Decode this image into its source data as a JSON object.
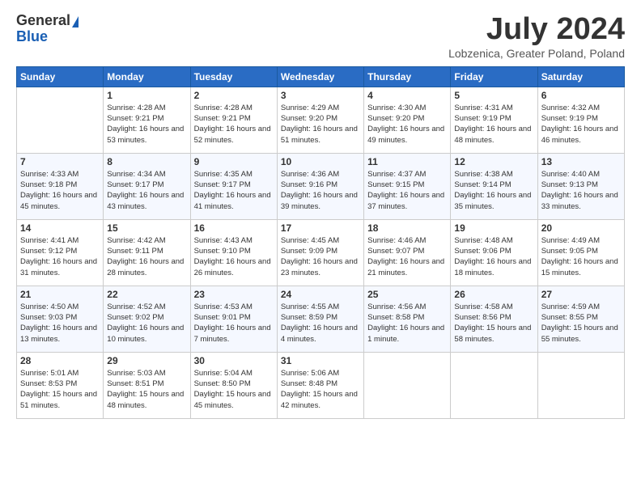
{
  "logo": {
    "general": "General",
    "blue": "Blue"
  },
  "title": "July 2024",
  "location": "Lobzenica, Greater Poland, Poland",
  "days_header": [
    "Sunday",
    "Monday",
    "Tuesday",
    "Wednesday",
    "Thursday",
    "Friday",
    "Saturday"
  ],
  "weeks": [
    [
      {
        "day": "",
        "info": ""
      },
      {
        "day": "1",
        "info": "Sunrise: 4:28 AM\nSunset: 9:21 PM\nDaylight: 16 hours\nand 53 minutes."
      },
      {
        "day": "2",
        "info": "Sunrise: 4:28 AM\nSunset: 9:21 PM\nDaylight: 16 hours\nand 52 minutes."
      },
      {
        "day": "3",
        "info": "Sunrise: 4:29 AM\nSunset: 9:20 PM\nDaylight: 16 hours\nand 51 minutes."
      },
      {
        "day": "4",
        "info": "Sunrise: 4:30 AM\nSunset: 9:20 PM\nDaylight: 16 hours\nand 49 minutes."
      },
      {
        "day": "5",
        "info": "Sunrise: 4:31 AM\nSunset: 9:19 PM\nDaylight: 16 hours\nand 48 minutes."
      },
      {
        "day": "6",
        "info": "Sunrise: 4:32 AM\nSunset: 9:19 PM\nDaylight: 16 hours\nand 46 minutes."
      }
    ],
    [
      {
        "day": "7",
        "info": "Sunrise: 4:33 AM\nSunset: 9:18 PM\nDaylight: 16 hours\nand 45 minutes."
      },
      {
        "day": "8",
        "info": "Sunrise: 4:34 AM\nSunset: 9:17 PM\nDaylight: 16 hours\nand 43 minutes."
      },
      {
        "day": "9",
        "info": "Sunrise: 4:35 AM\nSunset: 9:17 PM\nDaylight: 16 hours\nand 41 minutes."
      },
      {
        "day": "10",
        "info": "Sunrise: 4:36 AM\nSunset: 9:16 PM\nDaylight: 16 hours\nand 39 minutes."
      },
      {
        "day": "11",
        "info": "Sunrise: 4:37 AM\nSunset: 9:15 PM\nDaylight: 16 hours\nand 37 minutes."
      },
      {
        "day": "12",
        "info": "Sunrise: 4:38 AM\nSunset: 9:14 PM\nDaylight: 16 hours\nand 35 minutes."
      },
      {
        "day": "13",
        "info": "Sunrise: 4:40 AM\nSunset: 9:13 PM\nDaylight: 16 hours\nand 33 minutes."
      }
    ],
    [
      {
        "day": "14",
        "info": "Sunrise: 4:41 AM\nSunset: 9:12 PM\nDaylight: 16 hours\nand 31 minutes."
      },
      {
        "day": "15",
        "info": "Sunrise: 4:42 AM\nSunset: 9:11 PM\nDaylight: 16 hours\nand 28 minutes."
      },
      {
        "day": "16",
        "info": "Sunrise: 4:43 AM\nSunset: 9:10 PM\nDaylight: 16 hours\nand 26 minutes."
      },
      {
        "day": "17",
        "info": "Sunrise: 4:45 AM\nSunset: 9:09 PM\nDaylight: 16 hours\nand 23 minutes."
      },
      {
        "day": "18",
        "info": "Sunrise: 4:46 AM\nSunset: 9:07 PM\nDaylight: 16 hours\nand 21 minutes."
      },
      {
        "day": "19",
        "info": "Sunrise: 4:48 AM\nSunset: 9:06 PM\nDaylight: 16 hours\nand 18 minutes."
      },
      {
        "day": "20",
        "info": "Sunrise: 4:49 AM\nSunset: 9:05 PM\nDaylight: 16 hours\nand 15 minutes."
      }
    ],
    [
      {
        "day": "21",
        "info": "Sunrise: 4:50 AM\nSunset: 9:03 PM\nDaylight: 16 hours\nand 13 minutes."
      },
      {
        "day": "22",
        "info": "Sunrise: 4:52 AM\nSunset: 9:02 PM\nDaylight: 16 hours\nand 10 minutes."
      },
      {
        "day": "23",
        "info": "Sunrise: 4:53 AM\nSunset: 9:01 PM\nDaylight: 16 hours\nand 7 minutes."
      },
      {
        "day": "24",
        "info": "Sunrise: 4:55 AM\nSunset: 8:59 PM\nDaylight: 16 hours\nand 4 minutes."
      },
      {
        "day": "25",
        "info": "Sunrise: 4:56 AM\nSunset: 8:58 PM\nDaylight: 16 hours\nand 1 minute."
      },
      {
        "day": "26",
        "info": "Sunrise: 4:58 AM\nSunset: 8:56 PM\nDaylight: 15 hours\nand 58 minutes."
      },
      {
        "day": "27",
        "info": "Sunrise: 4:59 AM\nSunset: 8:55 PM\nDaylight: 15 hours\nand 55 minutes."
      }
    ],
    [
      {
        "day": "28",
        "info": "Sunrise: 5:01 AM\nSunset: 8:53 PM\nDaylight: 15 hours\nand 51 minutes."
      },
      {
        "day": "29",
        "info": "Sunrise: 5:03 AM\nSunset: 8:51 PM\nDaylight: 15 hours\nand 48 minutes."
      },
      {
        "day": "30",
        "info": "Sunrise: 5:04 AM\nSunset: 8:50 PM\nDaylight: 15 hours\nand 45 minutes."
      },
      {
        "day": "31",
        "info": "Sunrise: 5:06 AM\nSunset: 8:48 PM\nDaylight: 15 hours\nand 42 minutes."
      },
      {
        "day": "",
        "info": ""
      },
      {
        "day": "",
        "info": ""
      },
      {
        "day": "",
        "info": ""
      }
    ]
  ]
}
